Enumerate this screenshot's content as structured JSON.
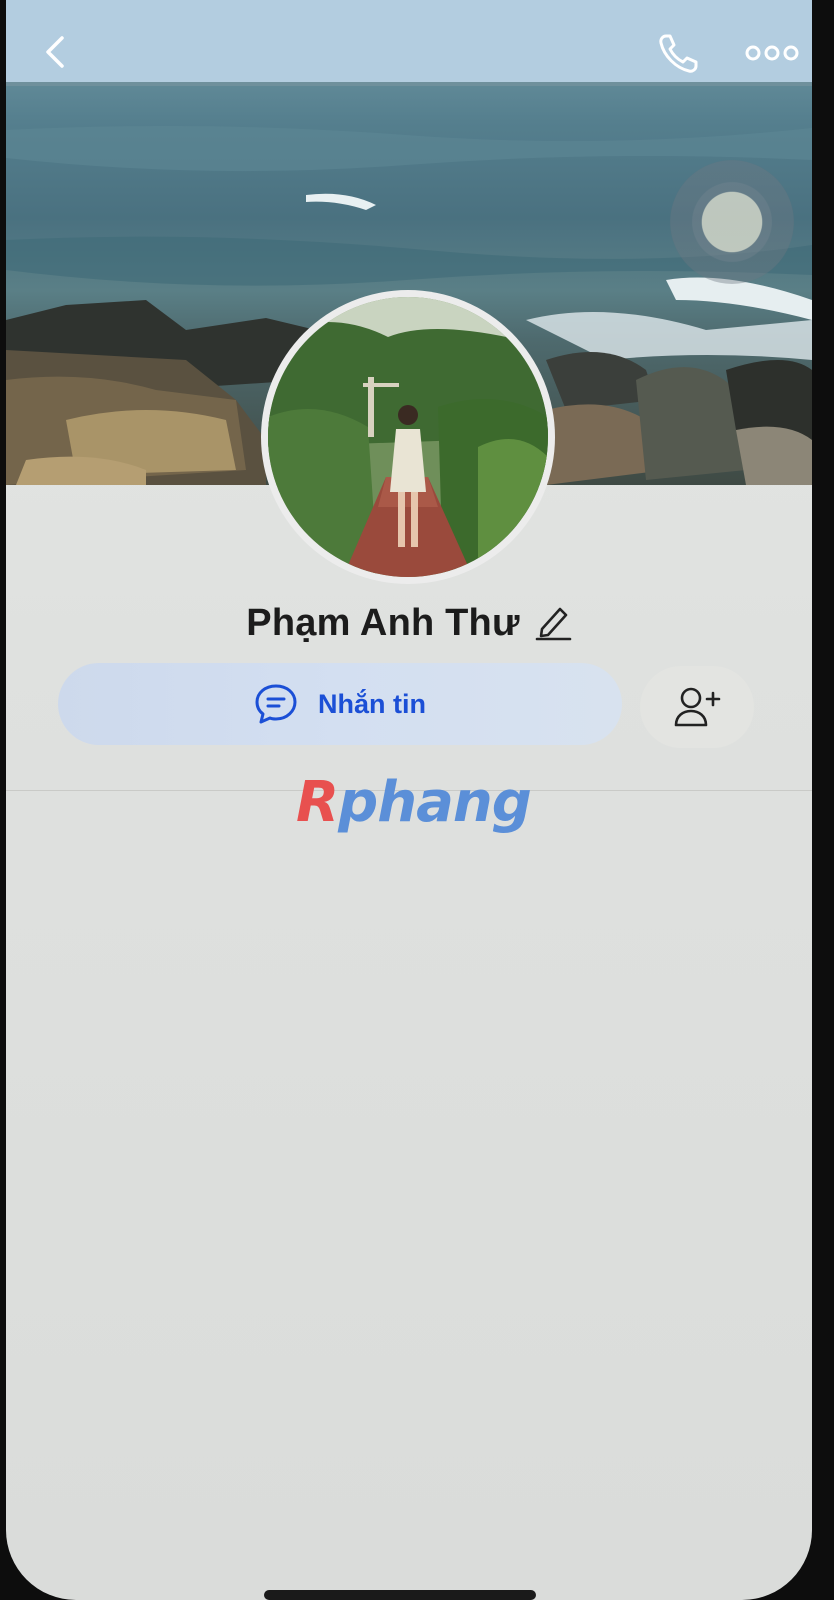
{
  "header": {
    "back_icon": "chevron-left-icon",
    "call_icon": "phone-icon",
    "more_icon": "more-dots-icon"
  },
  "profile": {
    "name": "Phạm Anh Thư",
    "edit_icon": "pencil-icon"
  },
  "actions": {
    "message_label": "Nhắn tin",
    "message_icon": "chat-bubble-icon",
    "add_friend_icon": "add-friend-icon"
  },
  "watermark": {
    "first": "R",
    "rest": "phang"
  },
  "colors": {
    "accent": "#1b4fd6",
    "message_bg": "#d3dff1",
    "page_bg": "#e2e4e2"
  }
}
